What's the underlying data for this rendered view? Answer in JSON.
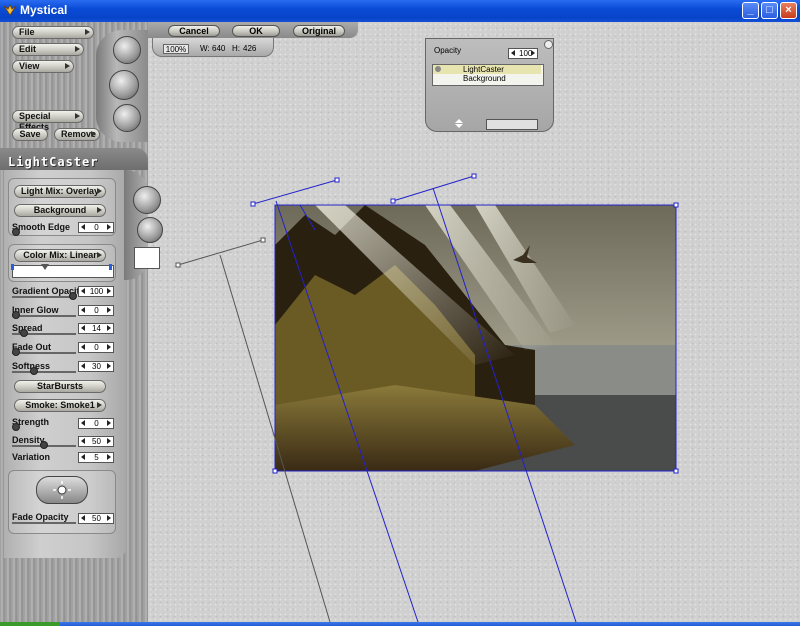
{
  "window": {
    "title": "Mystical"
  },
  "menu": {
    "file": "File",
    "edit": "Edit",
    "view": "View",
    "special_effects": "Special Effects",
    "save": "Save",
    "remove": "Remove"
  },
  "toolbar": {
    "cancel": "Cancel",
    "ok": "OK",
    "original": "Original"
  },
  "info": {
    "zoom": "100%",
    "width_label": "W:",
    "width": "640",
    "height_label": "H:",
    "height": "426"
  },
  "layers_panel": {
    "opacity_label": "Opacity",
    "opacity_value": "100",
    "layers": [
      "LightCaster",
      "Background"
    ]
  },
  "lightcaster": {
    "title": "LightCaster",
    "light_mix": "Light Mix: Overlay",
    "background": "Background",
    "smooth_edge_label": "Smooth Edge",
    "smooth_edge": "0",
    "color_mix": "Color Mix: Linear",
    "gradient_opacity_label": "Gradient Opacity",
    "gradient_opacity": "100",
    "inner_glow_label": "Inner Glow",
    "inner_glow": "0",
    "spread_label": "Spread",
    "spread": "14",
    "fade_out_label": "Fade Out",
    "fade_out": "0",
    "softness_label": "Softness",
    "softness": "30",
    "starbursts": "StarBursts",
    "smoke": "Smoke: Smoke1",
    "strength_label": "Strength",
    "strength": "0",
    "density_label": "Density",
    "density": "50",
    "variation_label": "Variation",
    "variation": "5",
    "fade_opacity_label": "Fade Opacity",
    "fade_opacity": "50"
  },
  "colors": {
    "titlebar": "#0a4bd6",
    "guide_line": "#2222cc",
    "panel": "#a8a8a8"
  }
}
